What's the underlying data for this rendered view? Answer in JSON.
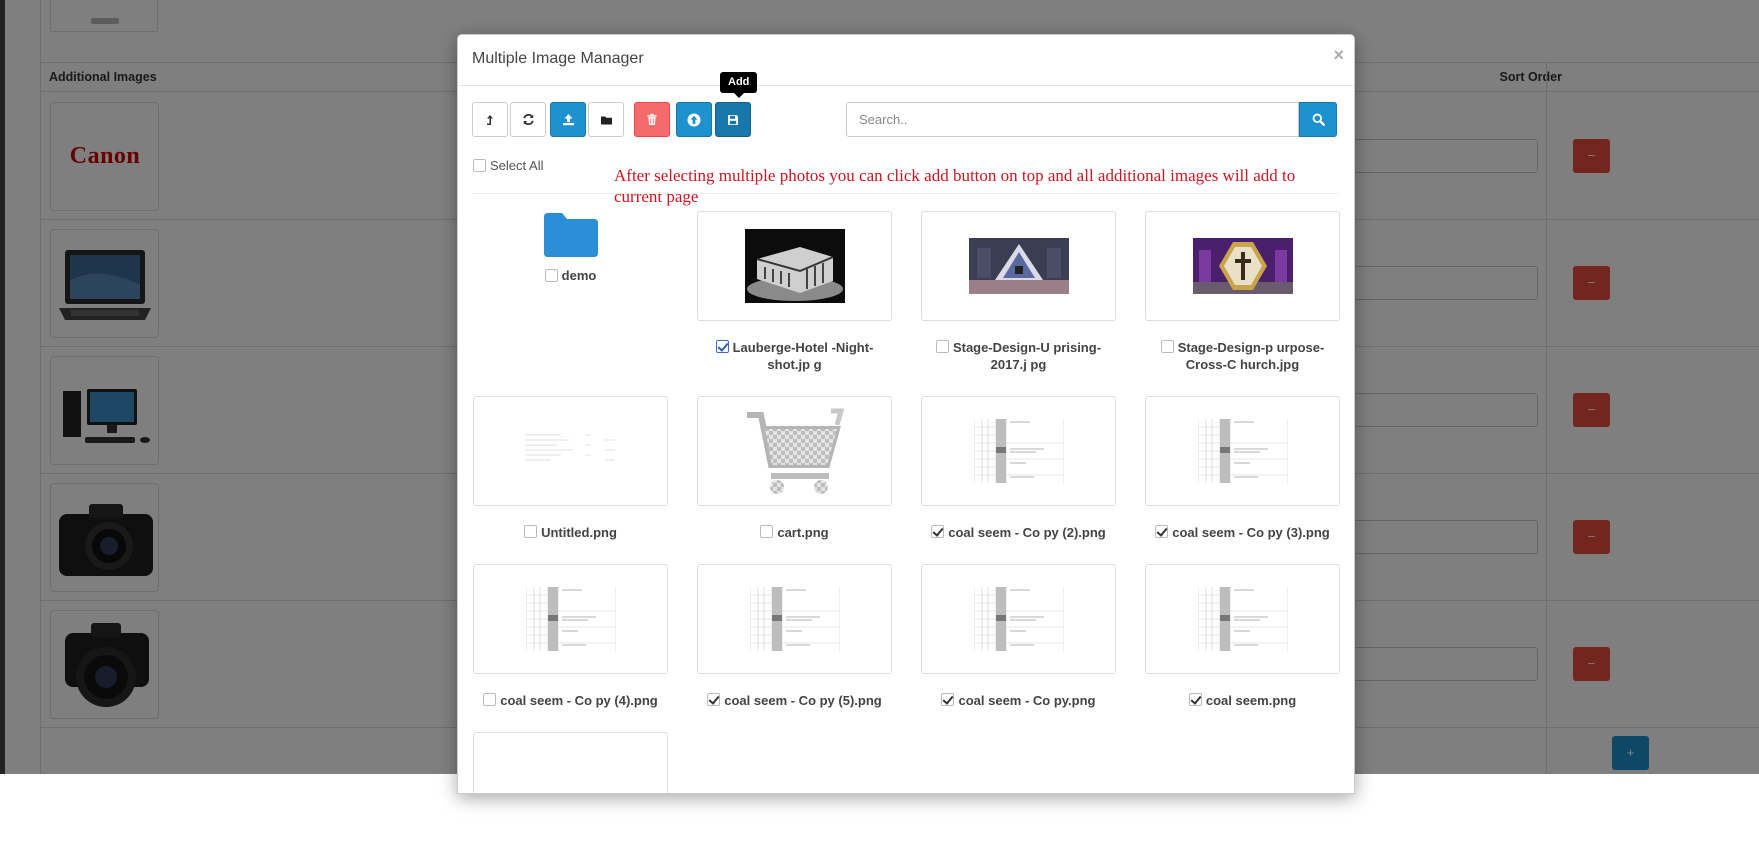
{
  "background": {
    "header": {
      "additional_images": "Additional Images",
      "sort_order": "Sort Order"
    },
    "rows": [
      {
        "thumb": "canon-logo",
        "brand_text": "Canon"
      },
      {
        "thumb": "laptop"
      },
      {
        "thumb": "desktop-computer"
      },
      {
        "thumb": "camera"
      },
      {
        "thumb": "camera-with-lens"
      }
    ]
  },
  "modal": {
    "title": "Multiple Image Manager",
    "close": "×",
    "tooltip": "Add",
    "toolbar": [
      {
        "name": "parent-folder-button",
        "icon": "level-up-icon",
        "style": "default"
      },
      {
        "name": "refresh-button",
        "icon": "refresh-icon",
        "style": "default"
      },
      {
        "name": "upload-button",
        "icon": "upload-icon",
        "style": "primary"
      },
      {
        "name": "new-folder-button",
        "icon": "folder-icon",
        "style": "default"
      },
      {
        "name": "delete-button",
        "icon": "trash-icon",
        "style": "danger"
      },
      {
        "name": "move-up-button",
        "icon": "arrow-up-icon",
        "style": "primary"
      },
      {
        "name": "add-button",
        "icon": "save-icon",
        "style": "primary-dark"
      }
    ],
    "search": {
      "placeholder": "Search.."
    },
    "select_all": "Select All",
    "annotation": "After selecting multiple photos you can click add button on top and all additional images will add to current page",
    "folder": {
      "label": "demo",
      "checked": false
    },
    "items": [
      {
        "label": "Lauberge-Hotel -Night-shot.jp g",
        "checked": true,
        "thumb": "night-building-photo"
      },
      {
        "label": "Stage-Design-U prising-2017.j pg",
        "checked": false,
        "thumb": "stage-triangle-photo"
      },
      {
        "label": "Stage-Design-p urpose-Cross-C hurch.jpg",
        "checked": false,
        "thumb": "stage-cross-photo"
      },
      {
        "label": "Untitled.png",
        "checked": false,
        "thumb": "blank-document"
      },
      {
        "label": "cart.png",
        "checked": false,
        "thumb": "shopping-cart"
      },
      {
        "label": "coal seem - Co py (2).png",
        "checked": true,
        "thumb": "log-sheet"
      },
      {
        "label": "coal seem - Co py (3).png",
        "checked": true,
        "thumb": "log-sheet"
      },
      {
        "label": "coal seem - Co py (4).png",
        "checked": false,
        "thumb": "log-sheet"
      },
      {
        "label": "coal seem - Co py (5).png",
        "checked": true,
        "thumb": "log-sheet"
      },
      {
        "label": "coal seem - Co py.png",
        "checked": true,
        "thumb": "log-sheet"
      },
      {
        "label": "coal seem.png",
        "checked": true,
        "thumb": "log-sheet"
      }
    ]
  },
  "colors": {
    "primary": "#1e91cf",
    "danger": "#f56b6b",
    "danger_bg": "#e74c3c",
    "annotation": "#d0141f",
    "folder": "#2a8fd6"
  }
}
